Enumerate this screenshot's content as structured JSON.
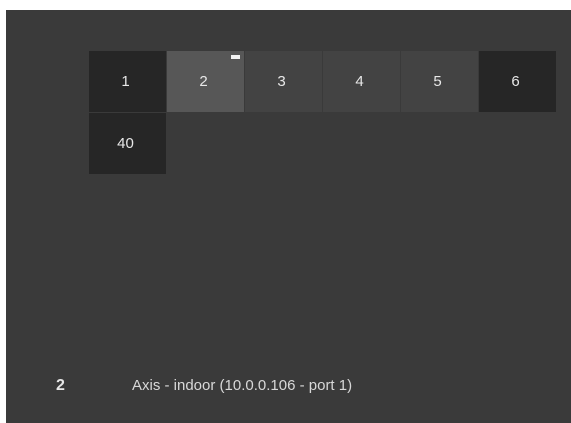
{
  "pager": {
    "pages": [
      "1",
      "2",
      "3",
      "4",
      "5",
      "6"
    ],
    "selected_index": 1,
    "extra_page": "40"
  },
  "status": {
    "selected_number": "2",
    "camera_label": "Axis - indoor (10.0.0.106 - port 1)"
  }
}
